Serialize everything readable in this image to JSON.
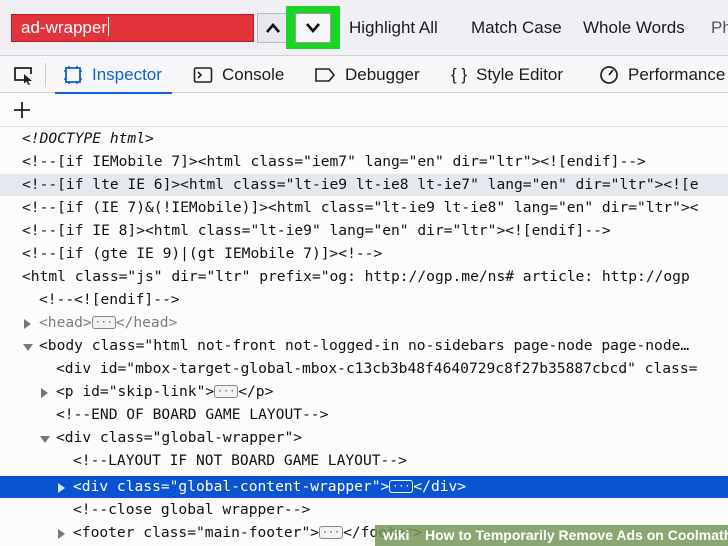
{
  "findbar": {
    "query": "ad-wrapper",
    "options": [
      "Highlight All",
      "Match Case",
      "Whole Words",
      "Ph"
    ],
    "accent": "#18d624",
    "input_color": "#e3343c"
  },
  "tabs": [
    {
      "label": "Inspector",
      "icon": "inspector-icon"
    },
    {
      "label": "Console",
      "icon": "console-icon"
    },
    {
      "label": "Debugger",
      "icon": "debugger-icon"
    },
    {
      "label": "Style Editor",
      "icon": "style-editor-icon"
    },
    {
      "label": "Performance",
      "icon": "performance-icon"
    }
  ],
  "tree": [
    {
      "text": "<!DOCTYPE html>",
      "cls": "c-dt"
    },
    {
      "text": "<!--[if IEMobile 7]><html class=\"iem7\" lang=\"en\" dir=\"ltr\"><![endif]-->"
    },
    {
      "text": "<!--[if lte IE 6]><html class=\"lt-ie9 lt-ie8 lt-ie7\" lang=\"en\" dir=\"ltr\"><![e"
    },
    {
      "text": "<!--[if (IE 7)&(!IEMobile)]><html class=\"lt-ie9 lt-ie8\" lang=\"en\" dir=\"ltr\"><"
    },
    {
      "text": "<!--[if IE 8]><html class=\"lt-ie9\" lang=\"en\" dir=\"ltr\"><![endif]-->"
    },
    {
      "text": "<!--[if (gte IE 9)|(gt IEMobile 7)]><!-->"
    },
    {
      "text": "<html class=\"js\" dir=\"ltr\" prefix=\"og: http://ogp.me/ns# article: http://ogp"
    },
    {
      "text": "<!--<![endif]-->"
    },
    {
      "text": "<head>",
      "after": "</head>"
    },
    {
      "text": "<body class=\"html not-front not-logged-in no-sidebars page-node page-node…"
    },
    {
      "text": "<div id=\"mbox-target-global-mbox-c13cb3b48f4640729c8f27b35887cbcd\" class="
    },
    {
      "text": "<p id=\"skip-link\">",
      "after": "</p>"
    },
    {
      "text": "<!--END OF BOARD GAME LAYOUT-->"
    },
    {
      "text": "<div class=\"global-wrapper\">"
    },
    {
      "text": "<!--LAYOUT IF NOT BOARD GAME LAYOUT-->"
    },
    {
      "text": "<div class=\"global-content-wrapper\">",
      "after": "</div>"
    },
    {
      "text": "<!--close global wrapper-->"
    },
    {
      "text": "<footer class=\"main-footer\">",
      "after": "</footer>"
    }
  ],
  "banner": {
    "logo": "wiki",
    "text": "How to Temporarily Remove Ads on Coolmath"
  }
}
